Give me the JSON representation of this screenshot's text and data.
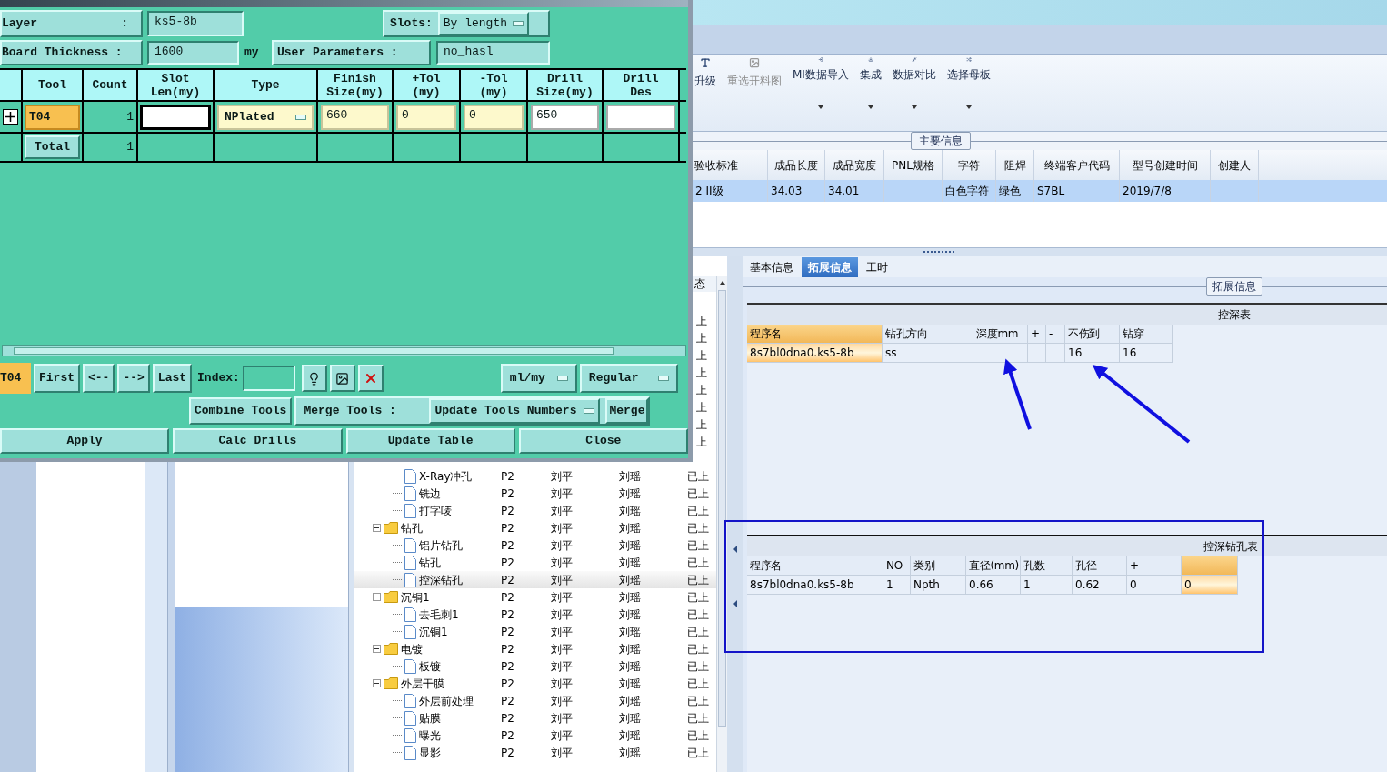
{
  "ribbon": {
    "items": [
      {
        "label": "升级",
        "kind": "letter",
        "disabled": false,
        "has_menu": false
      },
      {
        "label": "重选开料图",
        "kind": "image",
        "disabled": true,
        "has_menu": false
      },
      {
        "label": "MI数据导入",
        "kind": "import",
        "disabled": false,
        "has_menu": true
      },
      {
        "label": "集成",
        "kind": "download",
        "disabled": false,
        "has_menu": true
      },
      {
        "label": "数据对比",
        "kind": "compare",
        "disabled": false,
        "has_menu": true
      },
      {
        "label": "选择母板",
        "kind": "shuffle",
        "disabled": false,
        "has_menu": true
      }
    ]
  },
  "main_info": {
    "group_label": "主要信息",
    "columns": [
      "验收标准",
      "成品长度",
      "成品宽度",
      "PNL规格",
      "字符",
      "阻焊",
      "终端客户代码",
      "型号创建时间",
      "创建人"
    ],
    "row": {
      "selected": true,
      "cells": [
        "2 II级",
        "34.03",
        "34.01",
        null,
        "白色字符",
        "绿色",
        "S7BL",
        "2019/7/8",
        null
      ]
    }
  },
  "tree": {
    "header_status": "态",
    "covered_status": [
      "上",
      "上",
      "上",
      "上",
      "上",
      "上",
      "上",
      "上"
    ],
    "continued": [
      {
        "label": "X-Ray冲孔",
        "selected": false,
        "cells": [
          "P2",
          "刘平",
          "刘瑶",
          "已上"
        ]
      },
      {
        "label": "铣边",
        "selected": false,
        "cells": [
          "P2",
          "刘平",
          "刘瑶",
          "已上"
        ]
      },
      {
        "label": "打字唛",
        "selected": false,
        "cells": [
          "P2",
          "刘平",
          "刘瑶",
          "已上"
        ]
      }
    ],
    "items": [
      {
        "label": "钻孔",
        "expanded": true,
        "cells": [
          "P2",
          "刘平",
          "刘瑶",
          "已上"
        ],
        "children": [
          {
            "label": "铝片钻孔",
            "selected": false,
            "cells": [
              "P2",
              "刘平",
              "刘瑶",
              "已上"
            ]
          },
          {
            "label": "钻孔",
            "selected": false,
            "cells": [
              "P2",
              "刘平",
              "刘瑶",
              "已上"
            ]
          },
          {
            "label": "控深钻孔",
            "selected": true,
            "cells": [
              "P2",
              "刘平",
              "刘瑶",
              "已上"
            ]
          }
        ]
      },
      {
        "label": "沉铜1",
        "expanded": true,
        "cells": [
          "P2",
          "刘平",
          "刘瑶",
          "已上"
        ],
        "children": [
          {
            "label": "去毛刺1",
            "selected": false,
            "cells": [
              "P2",
              "刘平",
              "刘瑶",
              "已上"
            ]
          },
          {
            "label": "沉铜1",
            "selected": false,
            "cells": [
              "P2",
              "刘平",
              "刘瑶",
              "已上"
            ]
          }
        ]
      },
      {
        "label": "电镀",
        "expanded": true,
        "cells": [
          "P2",
          "刘平",
          "刘瑶",
          "已上"
        ],
        "children": [
          {
            "label": "板镀",
            "selected": false,
            "cells": [
              "P2",
              "刘平",
              "刘瑶",
              "已上"
            ]
          }
        ]
      },
      {
        "label": "外层干膜",
        "expanded": true,
        "cells": [
          "P2",
          "刘平",
          "刘瑶",
          "已上"
        ],
        "children": [
          {
            "label": "外层前处理",
            "selected": false,
            "cells": [
              "P2",
              "刘平",
              "刘瑶",
              "已上"
            ]
          },
          {
            "label": "贴膜",
            "selected": false,
            "cells": [
              "P2",
              "刘平",
              "刘瑶",
              "已上"
            ]
          },
          {
            "label": "曝光",
            "selected": false,
            "cells": [
              "P2",
              "刘平",
              "刘瑶",
              "已上"
            ]
          },
          {
            "label": "显影",
            "selected": false,
            "cells": [
              "P2",
              "刘平",
              "刘瑶",
              "已上"
            ]
          }
        ]
      }
    ]
  },
  "detail": {
    "tabs": [
      {
        "label": "基本信息",
        "selected": false
      },
      {
        "label": "拓展信息",
        "selected": true
      },
      {
        "label": "工时",
        "selected": false
      }
    ],
    "group_label": "拓展信息",
    "depth_table": {
      "title": "控深表",
      "columns": [
        {
          "label": "程序名",
          "highlighted": true
        },
        {
          "label": "钻孔方向",
          "highlighted": false
        },
        {
          "label": "深度mm",
          "highlighted": false
        },
        {
          "label": "+",
          "highlighted": false
        },
        {
          "label": "-",
          "highlighted": false
        },
        {
          "label": "不伤到",
          "highlighted": false
        },
        {
          "label": "钻穿",
          "highlighted": false
        }
      ],
      "rows": [
        [
          "8s7bl0dna0.ks5-8b",
          "ss",
          null,
          null,
          null,
          "16",
          "16"
        ]
      ]
    },
    "drill_table": {
      "title": "控深钻孔表",
      "columns": [
        {
          "label": "程序名",
          "highlighted": false
        },
        {
          "label": "NO",
          "highlighted": false
        },
        {
          "label": "类别",
          "highlighted": false
        },
        {
          "label": "直径(mm)",
          "highlighted": false
        },
        {
          "label": "孔数",
          "highlighted": false
        },
        {
          "label": "孔径",
          "highlighted": false
        },
        {
          "label": "+",
          "highlighted": false
        },
        {
          "label": "-",
          "highlighted": true
        }
      ],
      "rows": [
        [
          "8s7bl0dna0.ks5-8b",
          "1",
          "Npth",
          "0.66",
          "1",
          "0.62",
          "0",
          "0"
        ]
      ]
    }
  },
  "dialog": {
    "layer_label": "Layer",
    "layer_colon": ":",
    "layer_value": "ks5-8b",
    "slots_label": "Slots:",
    "slots_value": "By length",
    "thickness_label": "Board Thickness :",
    "thickness_value": "1600",
    "thickness_unit": "my",
    "user_params_label": "User Parameters :",
    "user_params_value": "no_hasl",
    "columns": [
      [
        "Tool"
      ],
      [
        "Count"
      ],
      [
        "Slot",
        "Len(my)"
      ],
      [
        "Type"
      ],
      [
        "Finish",
        "Size(my)"
      ],
      [
        "+Tol",
        "(my)"
      ],
      [
        "-Tol",
        "(my)"
      ],
      [
        "Drill",
        "Size(my)"
      ],
      [
        "Drill",
        "Des"
      ]
    ],
    "tool_row": {
      "tool": "T04",
      "count": "1",
      "type": "NPlated",
      "finish": "660",
      "plus_tol": "0",
      "minus_tol": "0",
      "drill_size": "650"
    },
    "total_row": {
      "label": "Total",
      "count": "1"
    },
    "current_tool": "T04",
    "nav_buttons": [
      "First",
      "<--",
      "-->",
      "Last"
    ],
    "index_label": "Index:",
    "units": "ml/my",
    "mode": "Regular",
    "combine": "Combine Tools",
    "merge_label": "Merge Tools :",
    "merge_option": "Update Tools Numbers",
    "merge": "Merge",
    "actions": [
      "Apply",
      "Calc Drills",
      "Update Table",
      "Close"
    ]
  }
}
